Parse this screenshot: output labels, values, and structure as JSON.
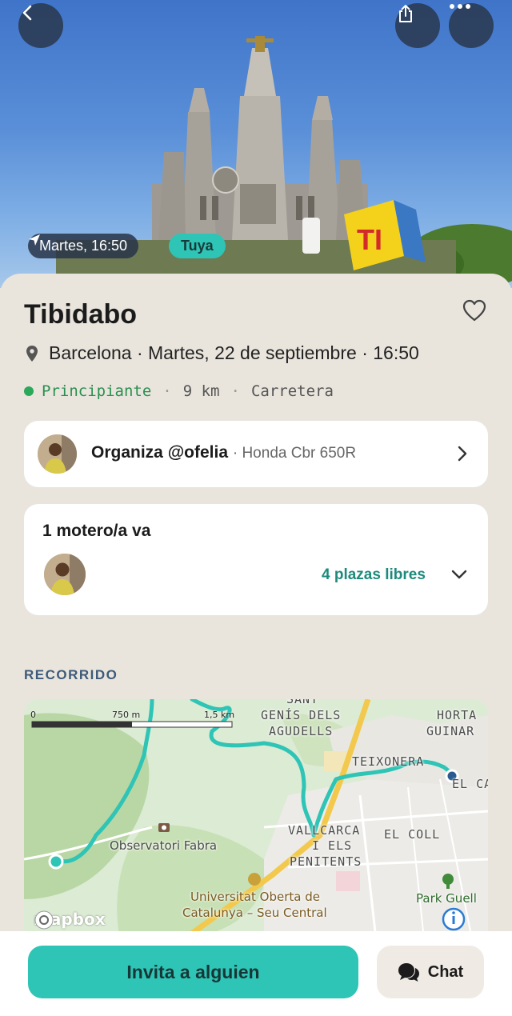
{
  "hero": {
    "date_chip": "Martes, 16:50",
    "owner_chip": "Tuya"
  },
  "event": {
    "title": "Tibidabo",
    "place_datetime": "Barcelona · Martes, 22 de septiembre · 16:50",
    "level": "Principiante",
    "distance": "9 km",
    "road_type": "Carretera"
  },
  "organizer": {
    "label": "Organiza @ofelia",
    "bike": "· Honda Cbr 650R"
  },
  "riders": {
    "title": "1 motero/a va",
    "free_spots": "4 plazas libres"
  },
  "route": {
    "section_label": "RECORRIDO",
    "map_labels": {
      "sant": "SANT",
      "genis": "GENÍS DELS",
      "agudells": "AGUDELLS",
      "horta": "HORTA",
      "guinar": "GUINAR",
      "teixonera": "TEIXONERA",
      "el_ca": "EL CA",
      "observatori": "Observatori Fabra",
      "vallcarca": "VALLCARCA",
      "els": "I ELS",
      "penitents": "PENITENTS",
      "el_coll": "EL COLL",
      "uoc1": "Universitat Oberta de",
      "uoc2": "Catalunya – Seu Central",
      "park_guell": "Park Guell"
    },
    "scale": {
      "zero": "0",
      "mid": "750 m",
      "end": "1,5 km"
    },
    "attribution": "mapbox"
  },
  "actions": {
    "invite": "Invita a alguien",
    "chat": "Chat"
  },
  "colors": {
    "accent": "#2ec4b6",
    "level_green": "#2aa95a",
    "route": "#2ec4b6",
    "background": "#e9e5dd"
  },
  "icons": {
    "back": "chevron-left-icon",
    "share": "share-icon",
    "more": "more-dots-icon",
    "navigation": "navigation-arrow-icon",
    "favorite": "heart-icon",
    "location": "location-pin-icon",
    "chat": "chat-bubble-icon"
  }
}
